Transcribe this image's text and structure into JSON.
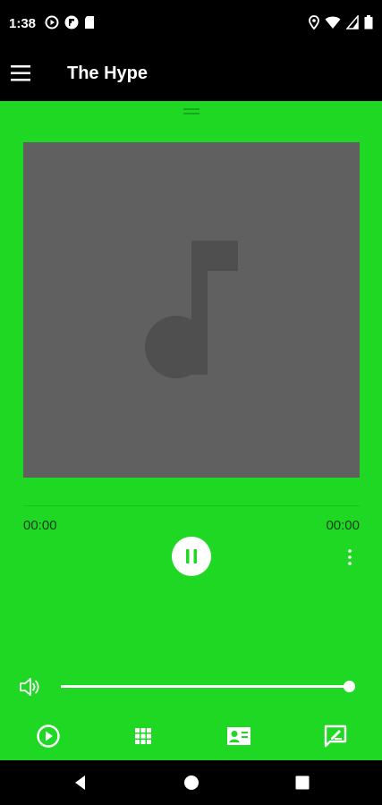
{
  "status_bar": {
    "time": "1:38",
    "left_icons": [
      "play-circle-icon",
      "flipboard-icon",
      "sd-card-icon"
    ],
    "right_icons": [
      "location-icon",
      "wifi-icon",
      "signal-icon",
      "battery-icon"
    ]
  },
  "app_bar": {
    "title": "The Hype",
    "menu_icon": "hamburger-menu-icon"
  },
  "player": {
    "album_art_icon": "music-note-icon",
    "elapsed": "00:00",
    "duration": "00:00",
    "state": "playing",
    "volume_level": 1.0
  },
  "bottom_tabs": [
    {
      "name": "player",
      "icon": "play-circle-icon"
    },
    {
      "name": "grid",
      "icon": "grid-icon"
    },
    {
      "name": "contact",
      "icon": "contact-card-icon"
    },
    {
      "name": "feedback",
      "icon": "feedback-icon"
    }
  ],
  "colors": {
    "background": "#1ed824",
    "album_art": "#606060",
    "note": "#4f4f4f",
    "bars": "#000000",
    "foreground": "#ffffff"
  }
}
